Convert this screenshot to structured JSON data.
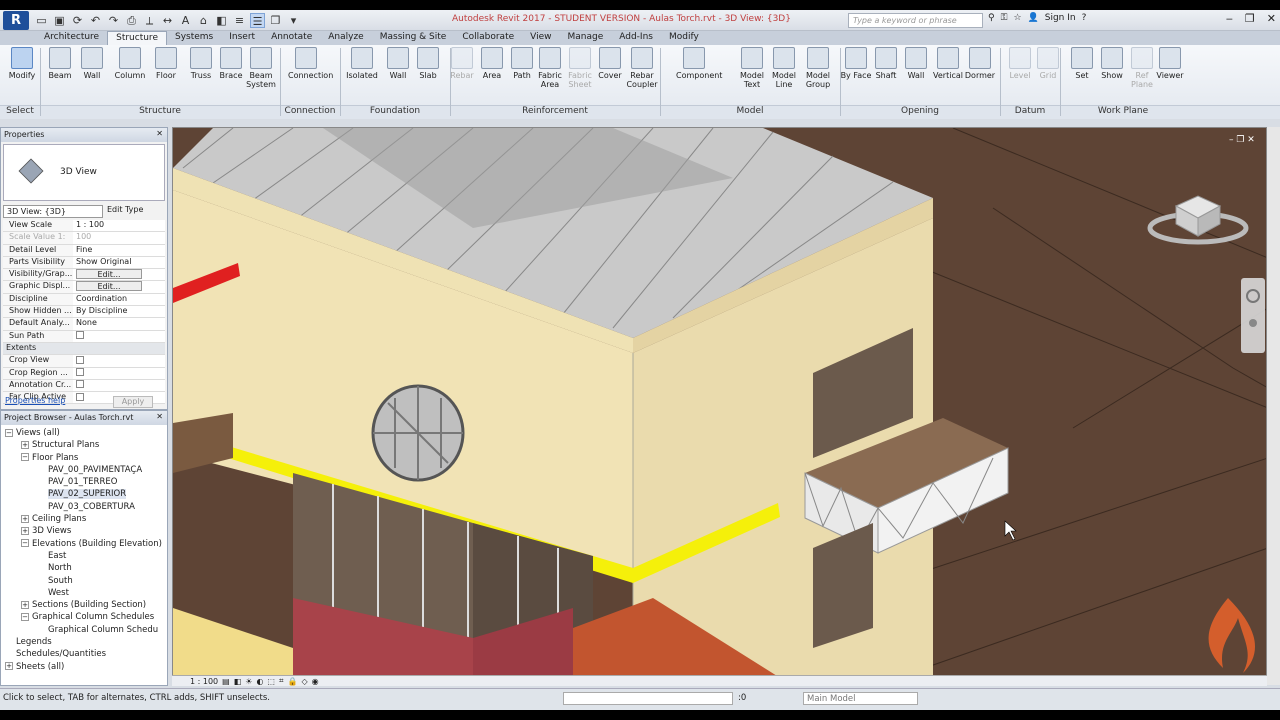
{
  "app": {
    "logo": "R",
    "window_title": "Autodesk Revit 2017 - STUDENT VERSION  -  Aulas Torch.rvt - 3D View: {3D}",
    "search_placeholder": "Type a keyword or phrase",
    "sign_in": "Sign In",
    "help": "?"
  },
  "tabs": [
    "Architecture",
    "Structure",
    "Systems",
    "Insert",
    "Annotate",
    "Analyze",
    "Massing & Site",
    "Collaborate",
    "View",
    "Manage",
    "Add-Ins",
    "Modify"
  ],
  "active_tab": "Structure",
  "ribbon": {
    "tools": [
      {
        "label": "Modify",
        "icon": "cursor-icon"
      },
      {
        "label": "Beam",
        "icon": "beam-icon"
      },
      {
        "label": "Wall",
        "icon": "wall-icon"
      },
      {
        "label": "Column",
        "icon": "column-icon"
      },
      {
        "label": "Floor",
        "icon": "floor-icon"
      },
      {
        "label": "Truss",
        "icon": "truss-icon"
      },
      {
        "label": "Brace",
        "icon": "brace-icon"
      },
      {
        "label": "Beam System",
        "icon": "beam-system-icon"
      },
      {
        "label": "Connection",
        "icon": "connection-icon"
      },
      {
        "label": "Isolated",
        "icon": "isolated-foundation-icon"
      },
      {
        "label": "Wall",
        "icon": "wall-foundation-icon"
      },
      {
        "label": "Slab",
        "icon": "slab-icon"
      },
      {
        "label": "Rebar",
        "icon": "rebar-icon"
      },
      {
        "label": "Area",
        "icon": "area-icon"
      },
      {
        "label": "Path",
        "icon": "path-icon"
      },
      {
        "label": "Fabric Area",
        "icon": "fabric-area-icon"
      },
      {
        "label": "Fabric Sheet",
        "icon": "fabric-sheet-icon"
      },
      {
        "label": "Cover",
        "icon": "cover-icon"
      },
      {
        "label": "Rebar Coupler",
        "icon": "rebar-coupler-icon"
      },
      {
        "label": "Component",
        "icon": "component-icon"
      },
      {
        "label": "Model Text",
        "icon": "model-text-icon"
      },
      {
        "label": "Model Line",
        "icon": "model-line-icon"
      },
      {
        "label": "Model Group",
        "icon": "model-group-icon"
      },
      {
        "label": "By Face",
        "icon": "by-face-icon"
      },
      {
        "label": "Shaft",
        "icon": "shaft-icon"
      },
      {
        "label": "Wall",
        "icon": "wall-opening-icon"
      },
      {
        "label": "Vertical",
        "icon": "vertical-icon"
      },
      {
        "label": "Dormer",
        "icon": "dormer-icon"
      },
      {
        "label": "Level",
        "icon": "level-icon"
      },
      {
        "label": "Grid",
        "icon": "grid-icon"
      },
      {
        "label": "Set",
        "icon": "set-icon"
      },
      {
        "label": "Show",
        "icon": "show-icon"
      },
      {
        "label": "Ref Plane",
        "icon": "ref-plane-icon"
      },
      {
        "label": "Viewer",
        "icon": "viewer-icon"
      }
    ],
    "panels": [
      "Select",
      "Structure",
      "Connection",
      "Foundation",
      "Reinforcement",
      "Model",
      "Opening",
      "Datum",
      "Work Plane"
    ]
  },
  "properties": {
    "title": "Properties",
    "type_name": "3D View",
    "selector": "3D View: {3D}",
    "edit_type": "Edit Type",
    "rows": [
      {
        "k": "View Scale",
        "v": "1 : 100"
      },
      {
        "k": "Scale Value   1:",
        "v": "100",
        "dim": true
      },
      {
        "k": "Detail Level",
        "v": "Fine"
      },
      {
        "k": "Parts Visibility",
        "v": "Show Original"
      },
      {
        "k": "Visibility/Grap...",
        "v": "Edit...",
        "btn": true
      },
      {
        "k": "Graphic Displ...",
        "v": "Edit...",
        "btn": true
      },
      {
        "k": "Discipline",
        "v": "Coordination"
      },
      {
        "k": "Show Hidden ...",
        "v": "By Discipline"
      },
      {
        "k": "Default Analy...",
        "v": "None"
      },
      {
        "k": "Sun Path",
        "v": "",
        "chk": true
      },
      {
        "k": "Extents",
        "v": "",
        "group": true
      },
      {
        "k": "Crop View",
        "v": "",
        "chk": true
      },
      {
        "k": "Crop Region ...",
        "v": "",
        "chk": true
      },
      {
        "k": "Annotation Cr...",
        "v": "",
        "chk": true
      },
      {
        "k": "Far Clip Active",
        "v": "",
        "chk": true
      }
    ],
    "help_link": "Properties help",
    "apply": "Apply"
  },
  "browser": {
    "title": "Project Browser - Aulas Torch.rvt",
    "nodes": [
      {
        "t": "Views (all)",
        "lvl": 0,
        "exp": "-"
      },
      {
        "t": "Structural Plans",
        "lvl": 1,
        "exp": "+"
      },
      {
        "t": "Floor Plans",
        "lvl": 1,
        "exp": "-"
      },
      {
        "t": "PAV_00_PAVIMENTAÇÃ",
        "lvl": 2
      },
      {
        "t": "PAV_01_TERREO",
        "lvl": 2
      },
      {
        "t": "PAV_02_SUPERIOR",
        "lvl": 2,
        "hl": true
      },
      {
        "t": "PAV_03_COBERTURA",
        "lvl": 2
      },
      {
        "t": "Ceiling Plans",
        "lvl": 1,
        "exp": "+"
      },
      {
        "t": "3D Views",
        "lvl": 1,
        "exp": "+"
      },
      {
        "t": "Elevations (Building Elevation)",
        "lvl": 1,
        "exp": "-"
      },
      {
        "t": "East",
        "lvl": 2
      },
      {
        "t": "North",
        "lvl": 2
      },
      {
        "t": "South",
        "lvl": 2
      },
      {
        "t": "West",
        "lvl": 2
      },
      {
        "t": "Sections (Building Section)",
        "lvl": 1,
        "exp": "+"
      },
      {
        "t": "Graphical Column Schedules",
        "lvl": 1,
        "exp": "-"
      },
      {
        "t": "Graphical Column Schedu",
        "lvl": 2
      },
      {
        "t": "Legends",
        "lvl": 0
      },
      {
        "t": "Schedules/Quantities",
        "lvl": 0
      },
      {
        "t": "Sheets (all)",
        "lvl": 0,
        "exp": "+"
      }
    ]
  },
  "viewbar": {
    "scale": "1 : 100"
  },
  "status": {
    "message": "Click to select, TAB for alternates, CTRL adds, SHIFT unselects.",
    "selection_count": ":0",
    "model": "Main Model"
  }
}
